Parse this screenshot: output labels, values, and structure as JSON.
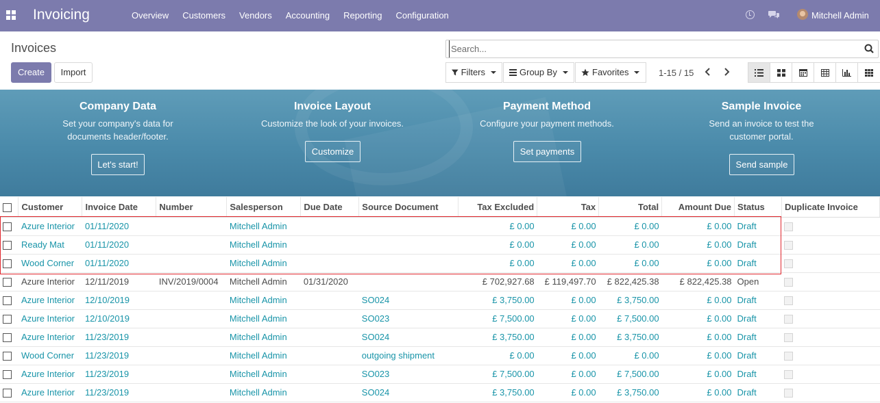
{
  "topbar": {
    "app_title": "Invoicing",
    "menu": [
      "Overview",
      "Customers",
      "Vendors",
      "Accounting",
      "Reporting",
      "Configuration"
    ],
    "user_name": "Mitchell Admin",
    "icons": [
      "apps-icon",
      "clock-icon",
      "chat-icon",
      "avatar"
    ]
  },
  "control": {
    "page_title": "Invoices",
    "create_label": "Create",
    "import_label": "Import",
    "search_placeholder": "Search...",
    "filters_label": "Filters",
    "groupby_label": "Group By",
    "favorites_label": "Favorites",
    "pager": "1-15 / 15"
  },
  "banner": {
    "steps": [
      {
        "title": "Company Data",
        "desc": "Set your company's data for documents header/footer.",
        "button": "Let's start!"
      },
      {
        "title": "Invoice Layout",
        "desc": "Customize the look of your invoices.",
        "button": "Customize"
      },
      {
        "title": "Payment Method",
        "desc": "Configure your payment methods.",
        "button": "Set payments"
      },
      {
        "title": "Sample Invoice",
        "desc": "Send an invoice to test the customer portal.",
        "button": "Send sample"
      }
    ]
  },
  "table": {
    "columns": [
      "Customer",
      "Invoice Date",
      "Number",
      "Salesperson",
      "Due Date",
      "Source Document",
      "Tax Excluded",
      "Tax",
      "Total",
      "Amount Due",
      "Status",
      "Duplicate Invoice"
    ],
    "rows": [
      {
        "customer": "Azure Interior",
        "date": "01/11/2020",
        "number": "",
        "salesperson": "Mitchell Admin",
        "due": "",
        "source": "",
        "tax_excl": "£ 0.00",
        "tax": "£ 0.00",
        "total": "£ 0.00",
        "amount_due": "£ 0.00",
        "status": "Draft"
      },
      {
        "customer": "Ready Mat",
        "date": "01/11/2020",
        "number": "",
        "salesperson": "Mitchell Admin",
        "due": "",
        "source": "",
        "tax_excl": "£ 0.00",
        "tax": "£ 0.00",
        "total": "£ 0.00",
        "amount_due": "£ 0.00",
        "status": "Draft"
      },
      {
        "customer": "Wood Corner",
        "date": "01/11/2020",
        "number": "",
        "salesperson": "Mitchell Admin",
        "due": "",
        "source": "",
        "tax_excl": "£ 0.00",
        "tax": "£ 0.00",
        "total": "£ 0.00",
        "amount_due": "£ 0.00",
        "status": "Draft"
      },
      {
        "customer": "Azure Interior",
        "date": "12/11/2019",
        "number": "INV/2019/0004",
        "salesperson": "Mitchell Admin",
        "due": "01/31/2020",
        "source": "",
        "tax_excl": "£ 702,927.68",
        "tax": "£ 119,497.70",
        "total": "£ 822,425.38",
        "amount_due": "£ 822,425.38",
        "status": "Open"
      },
      {
        "customer": "Azure Interior",
        "date": "12/10/2019",
        "number": "",
        "salesperson": "Mitchell Admin",
        "due": "",
        "source": "SO024",
        "tax_excl": "£ 3,750.00",
        "tax": "£ 0.00",
        "total": "£ 3,750.00",
        "amount_due": "£ 0.00",
        "status": "Draft"
      },
      {
        "customer": "Azure Interior",
        "date": "12/10/2019",
        "number": "",
        "salesperson": "Mitchell Admin",
        "due": "",
        "source": "SO023",
        "tax_excl": "£ 7,500.00",
        "tax": "£ 0.00",
        "total": "£ 7,500.00",
        "amount_due": "£ 0.00",
        "status": "Draft"
      },
      {
        "customer": "Azure Interior",
        "date": "11/23/2019",
        "number": "",
        "salesperson": "Mitchell Admin",
        "due": "",
        "source": "SO024",
        "tax_excl": "£ 3,750.00",
        "tax": "£ 0.00",
        "total": "£ 3,750.00",
        "amount_due": "£ 0.00",
        "status": "Draft"
      },
      {
        "customer": "Wood Corner",
        "date": "11/23/2019",
        "number": "",
        "salesperson": "Mitchell Admin",
        "due": "",
        "source": "outgoing shipment",
        "tax_excl": "£ 0.00",
        "tax": "£ 0.00",
        "total": "£ 0.00",
        "amount_due": "£ 0.00",
        "status": "Draft"
      },
      {
        "customer": "Azure Interior",
        "date": "11/23/2019",
        "number": "",
        "salesperson": "Mitchell Admin",
        "due": "",
        "source": "SO023",
        "tax_excl": "£ 7,500.00",
        "tax": "£ 0.00",
        "total": "£ 7,500.00",
        "amount_due": "£ 0.00",
        "status": "Draft"
      },
      {
        "customer": "Azure Interior",
        "date": "11/23/2019",
        "number": "",
        "salesperson": "Mitchell Admin",
        "due": "",
        "source": "SO024",
        "tax_excl": "£ 3,750.00",
        "tax": "£ 0.00",
        "total": "£ 3,750.00",
        "amount_due": "£ 0.00",
        "status": "Draft"
      }
    ]
  },
  "colors": {
    "brand": "#7c7bad",
    "link": "#1894a8",
    "banner": "#4a8aaa",
    "highlight": "#e0262c"
  }
}
